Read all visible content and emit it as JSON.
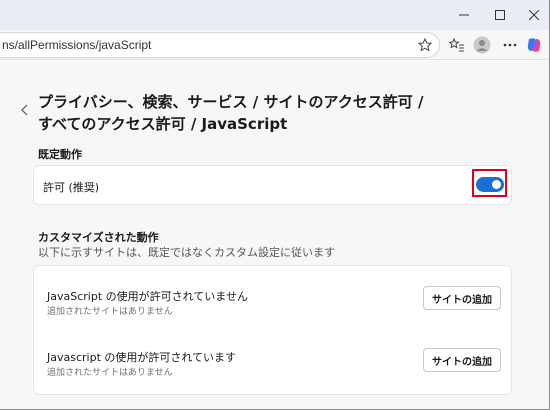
{
  "browser": {
    "url": "ns/allPermissions/javaScript"
  },
  "icons": {
    "minimize": "minimize-icon",
    "maximize": "maximize-icon",
    "close": "close-icon",
    "favorite": "star-icon",
    "favorites_bar": "favorites-icon",
    "profile": "profile-icon",
    "menu": "more-icon",
    "copilot": "copilot-icon",
    "back": "chevron-left-icon"
  },
  "page": {
    "title_line1": "プライバシー、検索、サービス / サイトのアクセス許可 /",
    "title_line2": "すべてのアクセス許可 / JavaScript",
    "default_section": {
      "label": "既定動作",
      "toggle_label": "許可 (推奨)",
      "toggle_on": true
    },
    "custom_section": {
      "label": "カスタマイズされた動作",
      "description": "以下に示すサイトは、既定ではなくカスタム設定に従います",
      "rows": [
        {
          "title": "JavaScript の使用が許可されていません",
          "subtitle": "追加されたサイトはありません",
          "button": "サイトの追加"
        },
        {
          "title": "Javascript の使用が許可されています",
          "subtitle": "追加されたサイトはありません",
          "button": "サイトの追加"
        }
      ]
    }
  },
  "colors": {
    "accent": "#1a6fd6",
    "highlight": "#e0001a",
    "copilot": "#7b5cff"
  }
}
